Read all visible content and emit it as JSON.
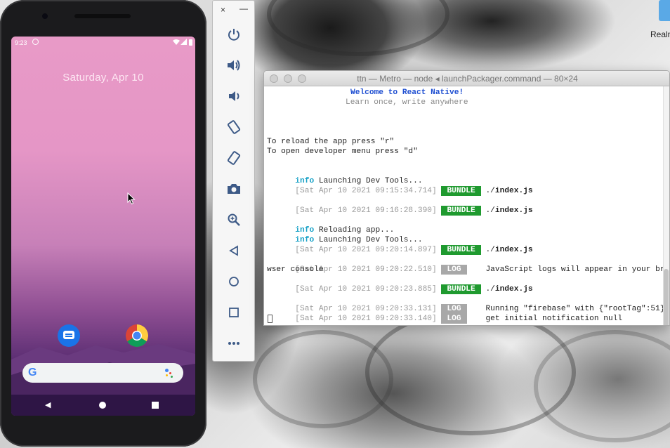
{
  "desktop": {
    "icon_label": "Realm"
  },
  "phone": {
    "status": {
      "time": "9:23"
    },
    "date": "Saturday, Apr 10",
    "apps": [
      {
        "name": "Messages"
      },
      {
        "name": "Chrome"
      }
    ],
    "search": {
      "logo": "G"
    },
    "nav": {
      "back": "◀"
    }
  },
  "emulator_toolbar": {
    "close": "×",
    "minimize": "—",
    "tools": [
      "power-icon",
      "volume-up-icon",
      "volume-down-icon",
      "rotate-left-icon",
      "rotate-right-icon",
      "camera-icon",
      "zoom-icon",
      "back-icon",
      "home-icon",
      "overview-icon",
      "more-icon"
    ]
  },
  "terminal": {
    "title": "ttn — Metro — node ◂ launchPackager.command — 80×24",
    "welcome": "Welcome to React Native!",
    "tagline": "Learn once, write anywhere",
    "reload_hint": "To reload the app press \"r\"",
    "devmenu_hint": "To open developer menu press \"d\"",
    "lines": [
      {
        "kind": "info",
        "label": "info",
        "text": "Launching Dev Tools..."
      },
      {
        "kind": "bundle",
        "ts": "[Sat Apr 10 2021 09:15:34.714]",
        "badge": "BUNDLE",
        "prefix": "./",
        "file": "index.js"
      },
      {
        "kind": "bundle",
        "ts": "[Sat Apr 10 2021 09:16:28.390]",
        "badge": "BUNDLE",
        "prefix": "./",
        "file": "index.js"
      },
      {
        "kind": "info",
        "label": "info",
        "text": "Reloading app..."
      },
      {
        "kind": "info",
        "label": "info",
        "text": "Launching Dev Tools..."
      },
      {
        "kind": "bundle",
        "ts": "[Sat Apr 10 2021 09:20:14.897]",
        "badge": "BUNDLE",
        "prefix": "./",
        "file": "index.js"
      },
      {
        "kind": "log",
        "ts": "[Sat Apr 10 2021 09:20:22.510]",
        "badge": "LOG",
        "text": "JavaScript logs will appear in your bro",
        "wrap": "wser console"
      },
      {
        "kind": "bundle",
        "ts": "[Sat Apr 10 2021 09:20:23.885]",
        "badge": "BUNDLE",
        "prefix": "./",
        "file": "index.js"
      },
      {
        "kind": "log",
        "ts": "[Sat Apr 10 2021 09:20:33.131]",
        "badge": "LOG",
        "text": "Running \"firebase\" with {\"rootTag\":51}"
      },
      {
        "kind": "log",
        "ts": "[Sat Apr 10 2021 09:20:33.140]",
        "badge": "LOG",
        "text": "get initial notification null"
      }
    ]
  }
}
